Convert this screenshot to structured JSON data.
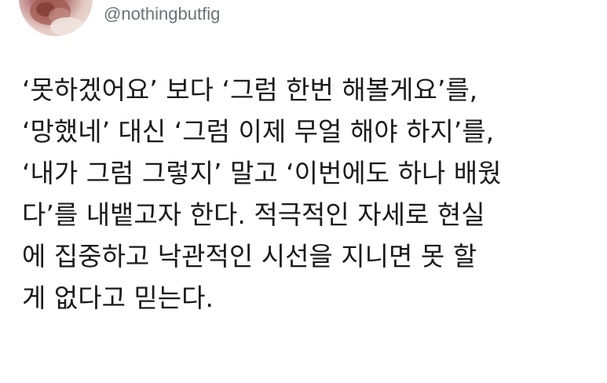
{
  "tweet": {
    "handle": "@nothingbutfig",
    "lines": [
      "‘못하겠어요’ 보다 ‘그럼 한번 해볼게요’를,",
      "‘망했네’ 대신 ‘그럼 이제 무얼 해야 하지’를,",
      "‘내가 그럼 그렇지’ 말고 ‘이번에도 하나 배웠",
      "다’를 내뱉고자 한다. 적극적인 자세로 현실",
      "에 집중하고 낙관적인 시선을 지니면 못 할",
      "게 없다고 믿는다."
    ]
  }
}
